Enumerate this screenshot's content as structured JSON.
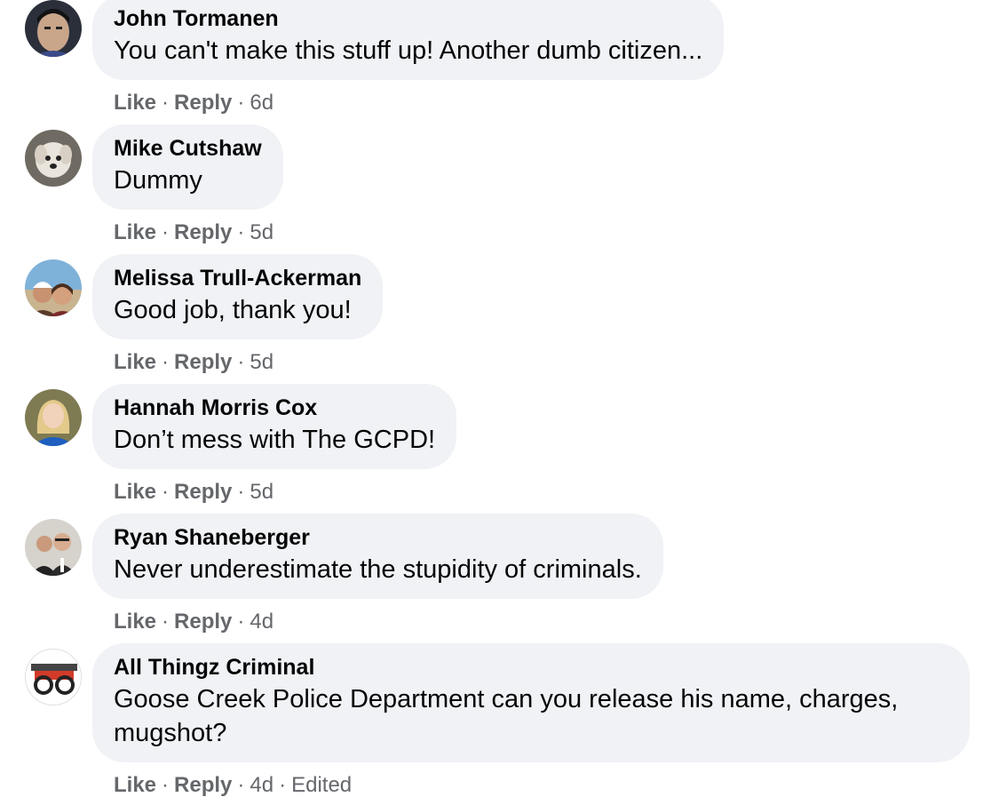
{
  "comments": [
    {
      "author": "John Tormanen",
      "text": "You can't make this stuff up! Another dumb citizen...",
      "like": "Like",
      "reply": "Reply",
      "time": "6d",
      "edited": ""
    },
    {
      "author": "Mike Cutshaw",
      "text": "Dummy",
      "like": "Like",
      "reply": "Reply",
      "time": "5d",
      "edited": ""
    },
    {
      "author": "Melissa Trull-Ackerman",
      "text": "Good job, thank you!",
      "like": "Like",
      "reply": "Reply",
      "time": "5d",
      "edited": ""
    },
    {
      "author": "Hannah Morris Cox",
      "text": "Don’t mess with The GCPD!",
      "like": "Like",
      "reply": "Reply",
      "time": "5d",
      "edited": ""
    },
    {
      "author": "Ryan Shaneberger",
      "text": "Never underestimate the stupidity of criminals.",
      "like": "Like",
      "reply": "Reply",
      "time": "4d",
      "edited": ""
    },
    {
      "author": "All Thingz Criminal",
      "text": "Goose Creek Police Department can you release his name, charges, mugshot?",
      "like": "Like",
      "reply": "Reply",
      "time": "4d",
      "edited": "Edited"
    }
  ],
  "separator": "·",
  "colors": {
    "bubble": "#f0f2f5",
    "meta": "#65676b",
    "text": "#050505"
  }
}
